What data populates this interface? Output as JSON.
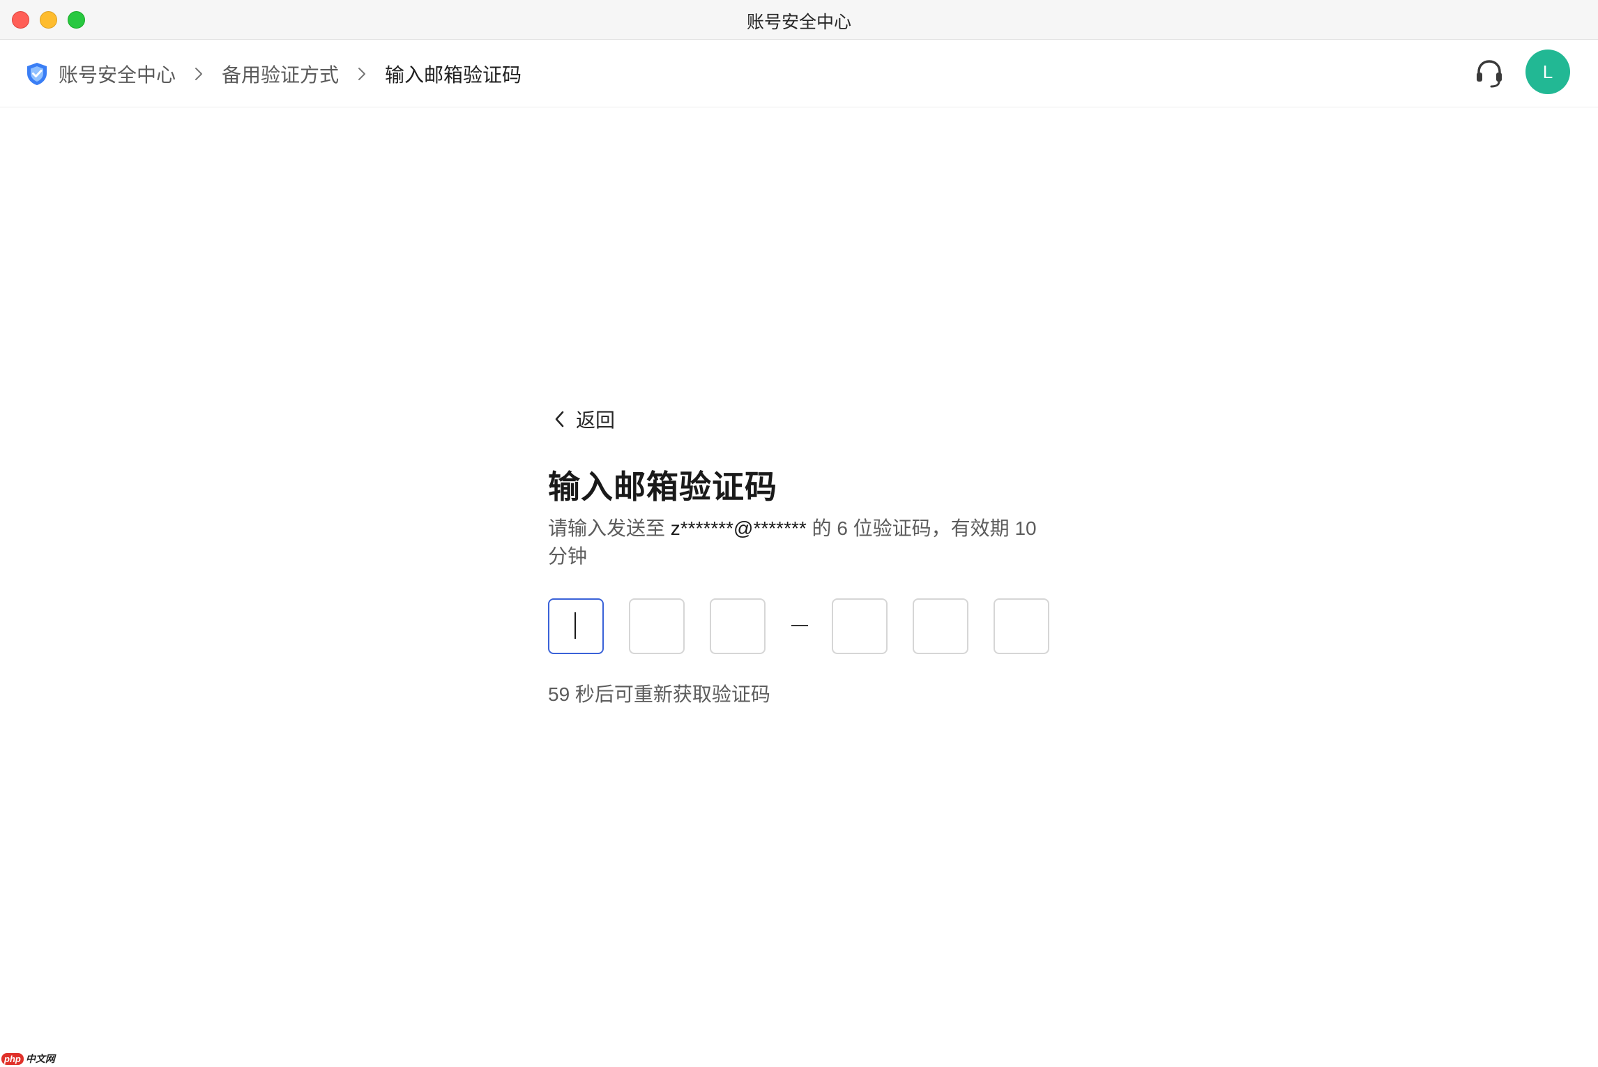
{
  "window": {
    "title": "账号安全中心"
  },
  "breadcrumb": {
    "items": [
      {
        "label": "账号安全中心",
        "icon": "shield-icon"
      },
      {
        "label": "备用验证方式"
      },
      {
        "label": "输入邮箱验证码"
      }
    ]
  },
  "header": {
    "support_icon": "headset-icon",
    "avatar_letter": "L",
    "avatar_color": "#22b894"
  },
  "main": {
    "back_label": "返回",
    "title": "输入邮箱验证码",
    "desc_prefix": "请输入发送至 ",
    "masked_email": "z*******@*******",
    "desc_suffix": " 的 6 位验证码，有效期 10 分钟",
    "code_digits": [
      "",
      "",
      "",
      "",
      "",
      ""
    ],
    "resend_text": "59 秒后可重新获取验证码"
  },
  "colors": {
    "accent": "#3a62d8",
    "shield": "#3a7ef5"
  },
  "watermark": {
    "logo": "php",
    "text": "中文网"
  }
}
